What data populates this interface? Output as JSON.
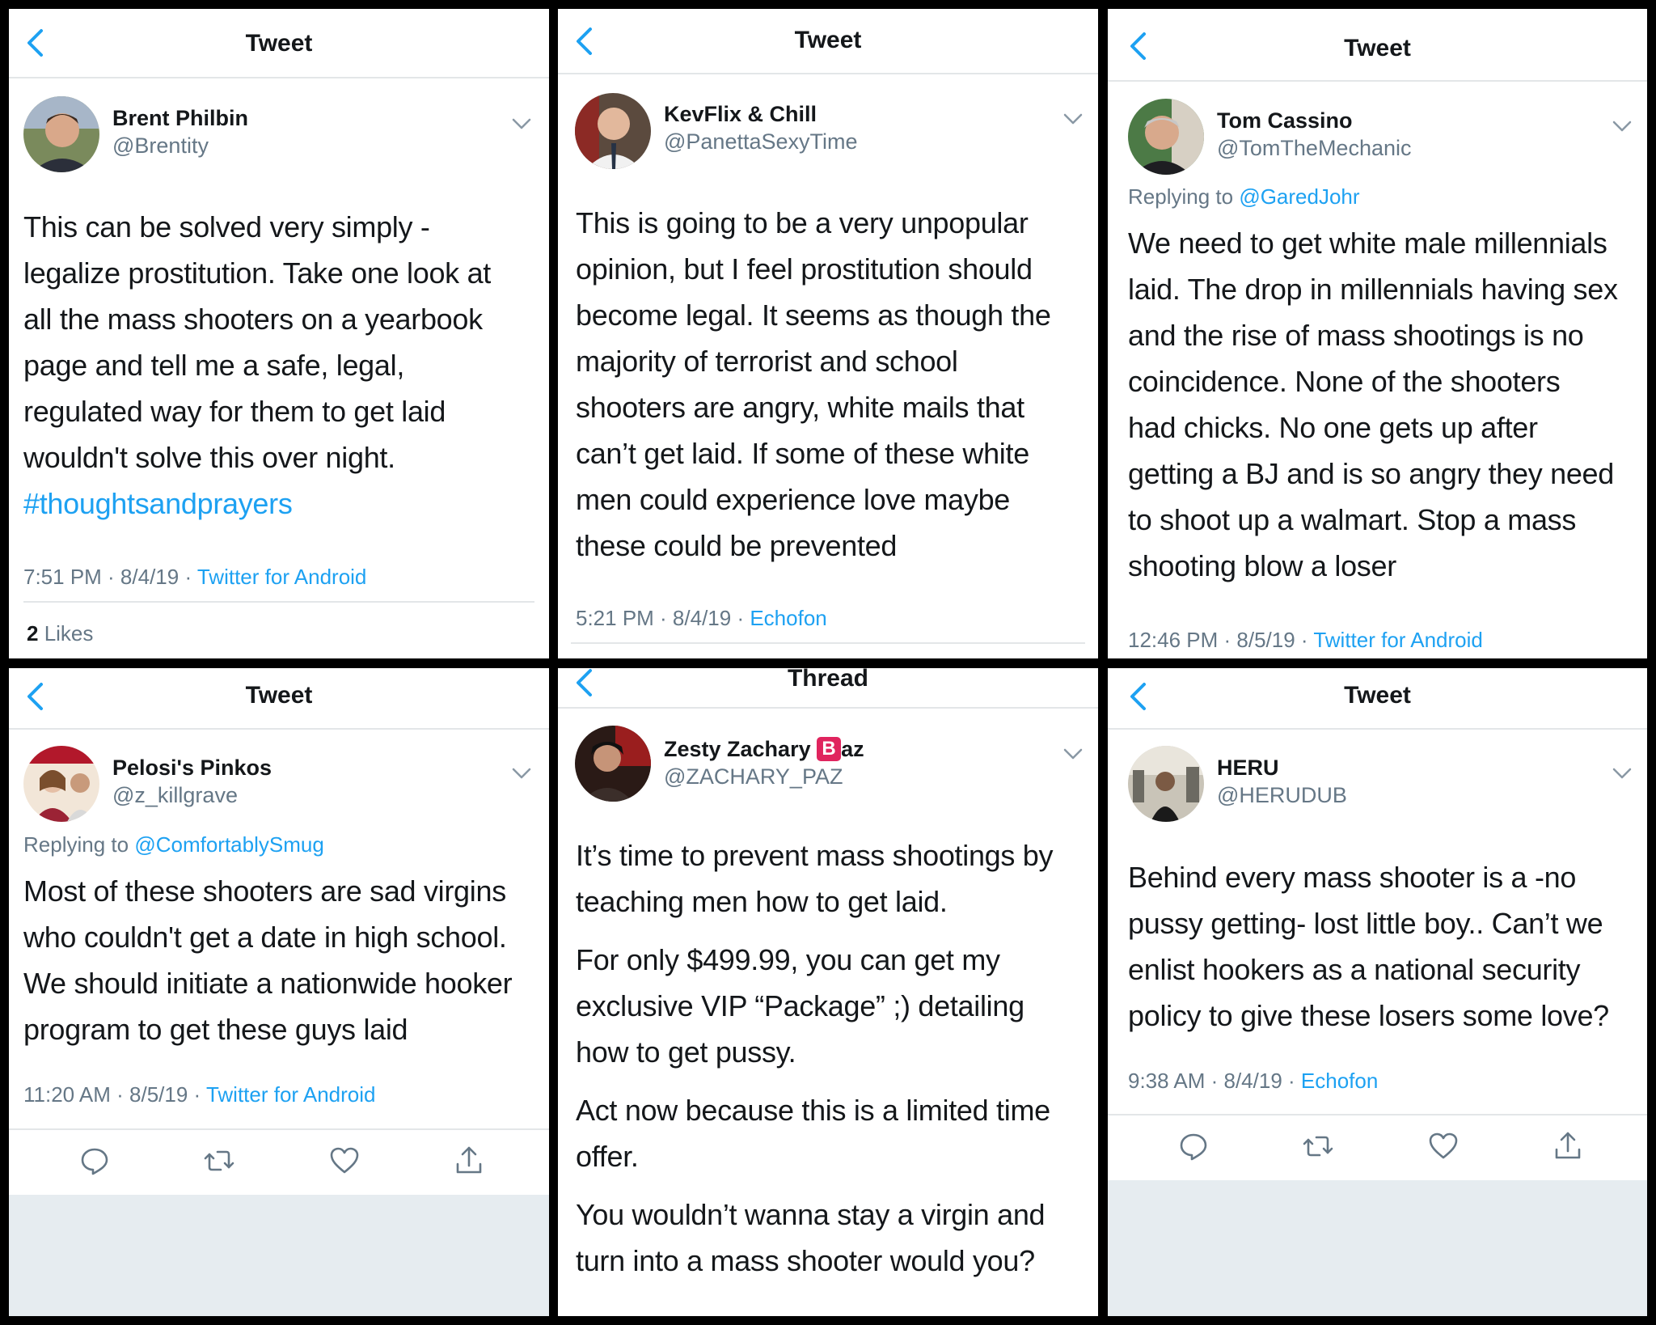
{
  "colors": {
    "accent": "#1da1f2",
    "text": "#14171a",
    "muted": "#657786",
    "divider": "#e3e6e8",
    "background_gray": "#e6ecf0"
  },
  "icons": {
    "back": "chevron-left-icon",
    "menu": "chevron-down-icon",
    "reply": "reply-bubble-icon",
    "retweet": "retweet-icon",
    "like": "heart-icon",
    "share": "share-icon"
  },
  "panels": [
    {
      "header": "Tweet",
      "name": "Brent Philbin",
      "handle": "@Brentity",
      "body_lines": [
        "This can be solved very simply -",
        "legalize prostitution. Take one look at",
        "all the mass shooters on a yearbook",
        "page and tell me a safe, legal,",
        "regulated way for them to get laid",
        "wouldn't solve this over night."
      ],
      "hashtag": "#thoughtsandprayers",
      "time": "7:51 PM · 8/4/19 · ",
      "source": "Twitter for Android",
      "likes_count": "2",
      "likes_label": " Likes"
    },
    {
      "header": "Tweet",
      "name": "KevFlix & Chill",
      "handle": "@PanettaSexyTime",
      "body_lines": [
        "This is going to be a very unpopular",
        "opinion, but I feel prostitution should",
        "become legal. It seems as though the",
        "majority of terrorist and school",
        "shooters are angry, white mails that",
        "can’t get laid. If some of these white",
        "men could experience love maybe",
        "these could be prevented"
      ],
      "time": "5:21 PM · 8/4/19 · ",
      "source": "Echofon"
    },
    {
      "header": "Tweet",
      "name": "Tom Cassino",
      "handle": "@TomTheMechanic",
      "replying_prefix": "Replying to ",
      "replying_to": "@GaredJohr",
      "body_lines": [
        "We need to get white male millennials",
        "laid. The drop in millennials having sex",
        "and the rise of mass shootings is no",
        "coincidence.  None of the shooters",
        "had chicks. No one gets up after",
        "getting a BJ and is so angry they need",
        "to shoot up a walmart. Stop a mass",
        "shooting blow a loser"
      ],
      "time": "12:46 PM · 8/5/19 · ",
      "source": "Twitter for Android"
    },
    {
      "header": "Tweet",
      "name": "Pelosi's Pinkos",
      "handle": "@z_killgrave",
      "replying_prefix": "Replying to ",
      "replying_to": "@ComfortablySmug",
      "body_lines": [
        "Most of these shooters are sad virgins",
        "who couldn't get a date in high school.",
        "We should initiate a nationwide hooker",
        "program to get these guys laid"
      ],
      "time": "11:20 AM · 8/5/19 · ",
      "source": "Twitter for Android"
    },
    {
      "header": "Thread",
      "name_prefix": "Zesty Zachary ",
      "name_badge": "B",
      "name_suffix": "az",
      "handle": "@ZACHARY_PAZ",
      "paragraphs": [
        [
          "It’s time to prevent mass shootings by",
          "teaching men how to get laid."
        ],
        [
          "For only $499.99, you can get my",
          "exclusive VIP “Package” ;) detailing",
          "how to get pussy."
        ],
        [
          "Act now because this is a limited time",
          "offer."
        ],
        [
          "You wouldn’t wanna stay a virgin and",
          "turn into a mass shooter would you?"
        ]
      ]
    },
    {
      "header": "Tweet",
      "name": "HERU",
      "handle": "@HERUDUB",
      "body_lines": [
        "Behind every mass shooter is a -no",
        "pussy getting- lost little boy.. Can’t we",
        "enlist hookers as a national security",
        "policy to give these losers some love?"
      ],
      "time": "9:38 AM · 8/4/19 · ",
      "source": "Echofon"
    }
  ]
}
